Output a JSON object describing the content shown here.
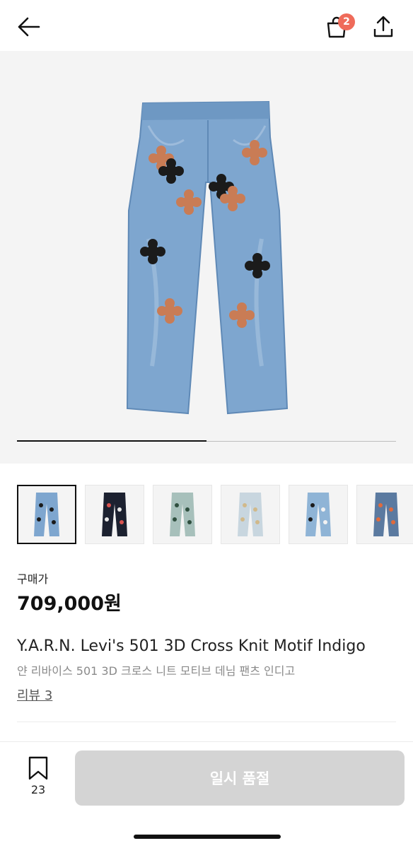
{
  "header": {
    "back_icon": "arrow-left-icon",
    "cart_icon": "shopping-bag-icon",
    "cart_badge": "2",
    "share_icon": "share-upload-icon",
    "badge_color": "#ef6b5a"
  },
  "gallery": {
    "progress_fraction": 0.5,
    "thumbnail_count": 6,
    "active_index": 0
  },
  "product": {
    "price_label": "구매가",
    "price": "709,000원",
    "title": "Y.A.R.N. Levi's 501 3D Cross Knit Motif Indigo",
    "subtitle": "얀 리바이스 501 3D 크로스 니트 모티브 데님 팬츠 인디고",
    "review_link": "리뷰 3"
  },
  "bottom_bar": {
    "bookmark_icon": "bookmark-icon",
    "bookmark_count": "23",
    "buy_button_label": "일시 품절",
    "buy_button_color": "#d4d4d4"
  }
}
